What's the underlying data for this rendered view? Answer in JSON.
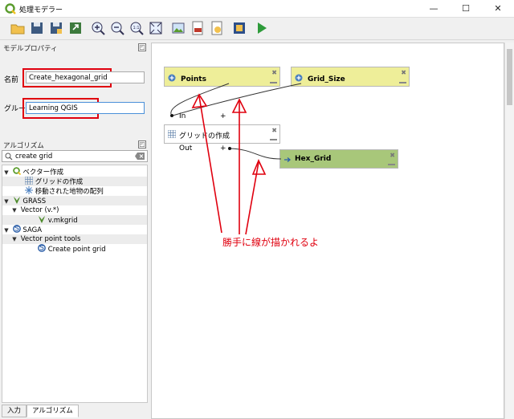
{
  "window": {
    "title": "処理モデラー",
    "minimize": "—",
    "maximize": "☐",
    "close": "✕"
  },
  "toolbar": {
    "icons": [
      "open-icon",
      "save-icon",
      "save-as-icon",
      "export-icon",
      "zoom-in-icon",
      "zoom-out-icon",
      "zoom-actual-icon",
      "zoom-full-icon",
      "export-image-icon",
      "export-pdf-icon",
      "export-svg-icon",
      "export-python-icon",
      "help-icon",
      "run-icon"
    ]
  },
  "model_properties": {
    "panel_title": "モデルプロパティ",
    "name_label": "名前",
    "name_value": "Create_hexagonal_grid",
    "group_label": "グループ",
    "group_value": "Learning QGIS"
  },
  "algorithms": {
    "panel_title": "アルゴリズム",
    "search_value": "create grid",
    "tree": [
      {
        "label": "ベクター作成",
        "level": 0,
        "expanded": true,
        "icon": "qgis-icon"
      },
      {
        "label": "グリッドの作成",
        "level": 1,
        "icon": "grid-icon"
      },
      {
        "label": "移動された地物の配列",
        "level": 1,
        "icon": "snowflake-icon"
      },
      {
        "label": "GRASS",
        "level": 0,
        "expanded": true,
        "icon": "grass-icon"
      },
      {
        "label": "Vector (v.*)",
        "level": 1,
        "expanded": true
      },
      {
        "label": "v.mkgrid",
        "level": 2,
        "icon": "grass-icon"
      },
      {
        "label": "SAGA",
        "level": 0,
        "expanded": true,
        "icon": "saga-icon"
      },
      {
        "label": "Vector point tools",
        "level": 1,
        "expanded": true
      },
      {
        "label": "Create point grid",
        "level": 2,
        "icon": "saga-icon"
      }
    ]
  },
  "tabs": {
    "input": "入力",
    "algorithms": "アルゴリズム"
  },
  "canvas": {
    "input_points": "Points",
    "input_grid_size": "Grid_Size",
    "alg_title": "グリッドの作成",
    "in_label": "In",
    "out_label": "Out",
    "plus": "+",
    "output": "Hex_Grid",
    "close_glyph": "✖"
  },
  "annotation": {
    "text": "勝手に線が描かれるよ",
    "color": "#e0000f"
  },
  "colors": {
    "input_fill": "#eeee99",
    "output_fill": "#a8c77a",
    "accent_red": "#e0000f"
  }
}
